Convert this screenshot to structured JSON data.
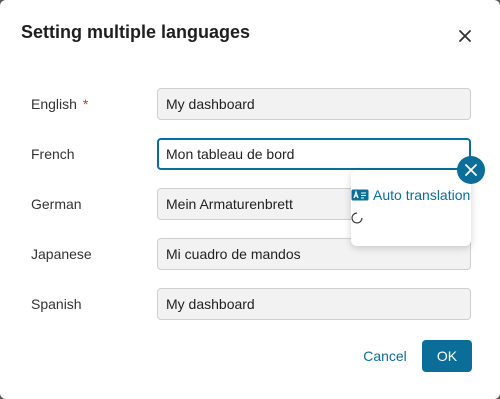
{
  "dialog": {
    "title": "Setting multiple languages",
    "close_icon": "close-icon"
  },
  "languages": [
    {
      "label": "English",
      "required": true,
      "required_mark": "*",
      "value": "My dashboard"
    },
    {
      "label": "French",
      "required": false,
      "value": "Mon tableau de bord"
    },
    {
      "label": "German",
      "required": false,
      "value": "Mein Armaturenbrett"
    },
    {
      "label": "Japanese",
      "required": false,
      "value": "Mi cuadro de mandos"
    },
    {
      "label": "Spanish",
      "required": false,
      "value": "My dashboard"
    }
  ],
  "popover": {
    "auto_translation_label": "Auto translation",
    "auto_translation_icon": "translate-icon",
    "loading_icon": "spinner-icon",
    "close_icon": "close-icon"
  },
  "footer": {
    "cancel_label": "Cancel",
    "ok_label": "OK"
  },
  "colors": {
    "accent": "#0b6e99",
    "required": "#d0312d"
  }
}
